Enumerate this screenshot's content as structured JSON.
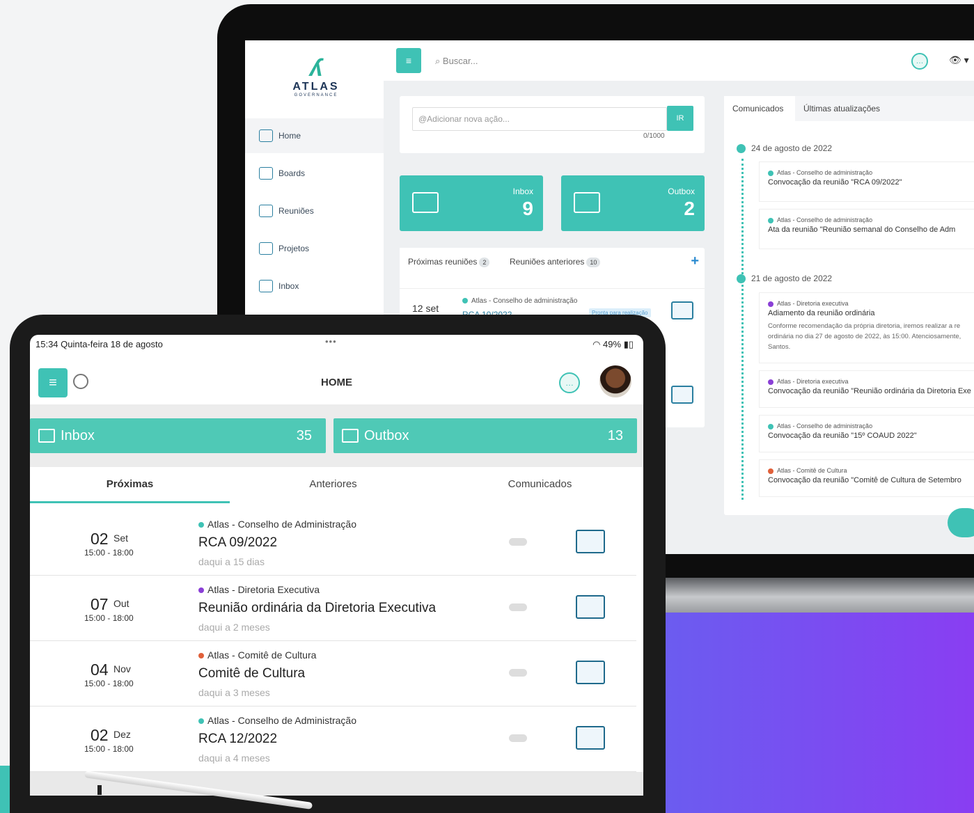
{
  "colors": {
    "accent": "#3fc2b5",
    "link": "#2a7fa0",
    "purple_dot": "#8a3fd6",
    "orange_dot": "#e0603a",
    "green_dot": "#3fc2b5"
  },
  "desktop": {
    "logo": {
      "name": "ATLAS",
      "sub": "GOVERNANCE"
    },
    "nav": [
      {
        "label": "Home",
        "icon": "home-icon"
      },
      {
        "label": "Boards",
        "icon": "users-icon"
      },
      {
        "label": "Reuniões",
        "icon": "calendar-icon"
      },
      {
        "label": "Projetos",
        "icon": "projects-icon"
      },
      {
        "label": "Inbox",
        "icon": "inbox-icon"
      }
    ],
    "search_placeholder": "Buscar...",
    "menu_icon": "≡",
    "add_action": {
      "placeholder": "@Adicionar nova ação...",
      "button": "IR",
      "counter": "0/1000"
    },
    "inbox": {
      "label": "Inbox",
      "count": "9"
    },
    "outbox": {
      "label": "Outbox",
      "count": "2"
    },
    "meetings": {
      "tabs": [
        {
          "label": "Próximas reuniões",
          "count": "2"
        },
        {
          "label": "Reuniões anteriores",
          "count": "10"
        }
      ],
      "add": "+",
      "row": {
        "date": "12 set",
        "org": "Atlas - Conselho de administração",
        "code": "RCA 10/2022",
        "status": "Pronta para realização"
      }
    },
    "communications": {
      "tabs": [
        "Comunicados",
        "Últimas atualizações"
      ],
      "groups": [
        {
          "date": "24 de agosto de 2022",
          "items": [
            {
              "org": "Atlas - Conselho de administração",
              "title": "Convocação da reunião \"RCA 09/2022\""
            },
            {
              "org": "Atlas - Conselho de administração",
              "title": "Ata da reunião \"Reunião semanal do Conselho de Adm"
            }
          ]
        },
        {
          "date": "21 de agosto de 2022",
          "items": [
            {
              "org": "Atlas - Diretoria executiva",
              "title": "Adiamento da reunião ordinária",
              "desc": "Conforme recomendação da própria diretoria, iremos realizar a re ordinária no dia 27 de agosto de 2022, às 15:00. Atenciosamente, Santos."
            },
            {
              "org": "Atlas - Diretoria executiva",
              "title": "Convocação da reunião \"Reunião ordinária da Diretoria Exe"
            },
            {
              "org": "Atlas - Conselho de administração",
              "title": "Convocação da reunião \"15º COAUD 2022\""
            },
            {
              "org": "Atlas - Comitê de Cultura",
              "title": "Convocação da reunião \"Comitê de Cultura de Setembro"
            }
          ]
        }
      ]
    }
  },
  "tablet": {
    "status": {
      "time": "15:34  Quinta-feira 18 de agosto",
      "dots": "•••",
      "battery": "49%"
    },
    "title": "HOME",
    "menu_icon": "≡",
    "inbox": {
      "label": "Inbox",
      "count": "35"
    },
    "outbox": {
      "label": "Outbox",
      "count": "13"
    },
    "tabs": [
      "Próximas",
      "Anteriores",
      "Comunicados"
    ],
    "meetings": [
      {
        "day": "02",
        "month": "Set",
        "hours": "15:00 - 18:00",
        "org": "Atlas - Conselho de Administração",
        "title": "RCA 09/2022",
        "relative": "daqui a 15 dias",
        "dot": "#3fc2b5"
      },
      {
        "day": "07",
        "month": "Out",
        "hours": "15:00 - 18:00",
        "org": "Atlas - Diretoria Executiva",
        "title": "Reunião ordinária da Diretoria Executiva",
        "relative": "daqui a 2 meses",
        "dot": "#8a3fd6"
      },
      {
        "day": "04",
        "month": "Nov",
        "hours": "15:00 - 18:00",
        "org": "Atlas - Comitê de Cultura",
        "title": "Comitê de Cultura",
        "relative": "daqui a 3 meses",
        "dot": "#e0603a"
      },
      {
        "day": "02",
        "month": "Dez",
        "hours": "15:00 - 18:00",
        "org": "Atlas - Conselho de Administração",
        "title": "RCA 12/2022",
        "relative": "daqui a 4 meses",
        "dot": "#3fc2b5"
      }
    ]
  }
}
